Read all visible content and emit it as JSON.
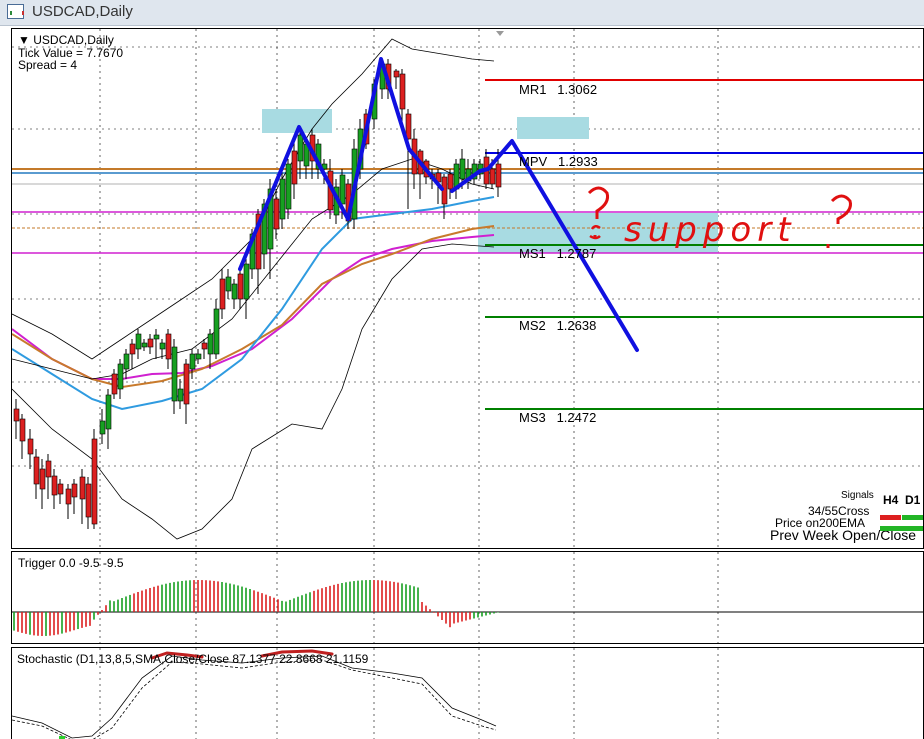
{
  "window": {
    "title": "USDCAD,Daily",
    "icon": "chart-window-icon"
  },
  "main_chart": {
    "header_symbol": "USDCAD,Daily",
    "tick_value": "Tick Value = 7.7670",
    "spread": "Spread = 4",
    "levels": [
      {
        "label": "MR1",
        "value": "1.3062",
        "color": "#e00000"
      },
      {
        "label": "MPV",
        "value": "1.2933",
        "color": "#0000e0"
      },
      {
        "label": "MS1",
        "value": "1.2787",
        "color": "#008000"
      },
      {
        "label": "MS2",
        "value": "1.2638",
        "color": "#008000"
      },
      {
        "label": "MS3",
        "value": "1.2472",
        "color": "#008000"
      }
    ],
    "annotation_text": "support",
    "question_marks": [
      "?",
      "?"
    ],
    "colors": {
      "bull_candle": "#17a021",
      "bear_candle": "#dc2020",
      "drawing": "#1010e0",
      "annotation": "#e01010",
      "ema_blue": "#2f9be0",
      "ema_orange": "#c87a2c",
      "ema_magenta": "#d020d0",
      "zone": "#a8dbe2"
    }
  },
  "signals_panel": {
    "title": "Signals",
    "columns": [
      "H4",
      "D1"
    ],
    "rows": [
      "34/55Cross",
      "Price on200EMA",
      "Prev Week Open/Close"
    ]
  },
  "trigger_indicator": {
    "label": "Trigger 0.0 -9.5 -9.5"
  },
  "stochastic_indicator": {
    "label": "Stochastic (D1,13,8,5,SMA,Close/Close 87.1377 22.8668 21.1159"
  }
}
